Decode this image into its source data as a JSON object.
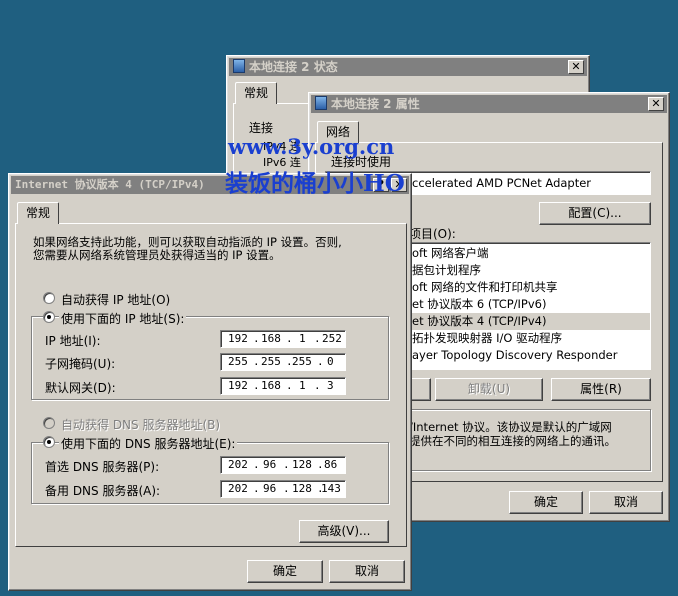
{
  "status_window": {
    "title": "本地连接 2 状态",
    "close_glyph": "✕",
    "tab": "常规",
    "connection_label": "连接",
    "ipv4_label": "IPv4 连",
    "ipv6_label": "IPv6 连"
  },
  "props_window": {
    "title": "本地连接 2 属性",
    "close_glyph": "✕",
    "tab": "网络",
    "connect_using_label": "连接时使用",
    "adapter": "ccelerated AMD PCNet Adapter",
    "configure_button": "配置(C)...",
    "items_label": "项目(O):",
    "items": [
      "oft 网络客户端",
      "据包计划程序",
      "oft 网络的文件和打印机共享",
      "et 协议版本 6 (TCP/IPv6)",
      "et 协议版本 4 (TCP/IPv4)",
      "拓扑发现映射器 I/O 驱动程序",
      "ayer Topology Discovery Responder"
    ],
    "selected_index": 4,
    "uninstall_button": "卸载(U)",
    "properties_button": "属性(R)",
    "desc_line1": "/Internet 协议。该协议是默认的广域网",
    "desc_line2": "提供在不同的相互连接的网络上的通讯。",
    "ok_button": "确定",
    "cancel_button": "取消"
  },
  "ipv4_window": {
    "title": "Internet 协议版本 4 (TCP/IPv4)",
    "help_glyph": "?",
    "close_glyph": "✕",
    "tab": "常规",
    "intro_line1": "如果网络支持此功能，则可以获取自动指派的 IP 设置。否则,",
    "intro_line2": "您需要从网络系统管理员处获得适当的 IP 设置。",
    "auto_ip_label": "自动获得 IP 地址(O)",
    "manual_ip_label": "使用下面的 IP 地址(S):",
    "ip_label": "IP 地址(I):",
    "ip_value": [
      "192",
      "168",
      "1",
      "252"
    ],
    "subnet_label": "子网掩码(U):",
    "subnet_value": [
      "255",
      "255",
      "255",
      "0"
    ],
    "gateway_label": "默认网关(D):",
    "gateway_value": [
      "192",
      "168",
      "1",
      "3"
    ],
    "auto_dns_label": "自动获得 DNS 服务器地址(B)",
    "manual_dns_label": "使用下面的 DNS 服务器地址(E):",
    "preferred_dns_label": "首选 DNS 服务器(P):",
    "preferred_dns_value": [
      "202",
      "96",
      "128",
      "86"
    ],
    "alternate_dns_label": "备用 DNS 服务器(A):",
    "alternate_dns_value": [
      "202",
      "96",
      "128",
      "143"
    ],
    "advanced_button": "高级(V)...",
    "ok_button": "确定",
    "cancel_button": "取消"
  },
  "watermark": {
    "line1": "www.3y.org.cn",
    "line2": "装饭的桶小小HO"
  },
  "colors": {
    "desktop": "#1f5f80",
    "window": "#d4d0c8",
    "inactive_title": "#808080",
    "watermark_blue": "#1a3fd0"
  }
}
